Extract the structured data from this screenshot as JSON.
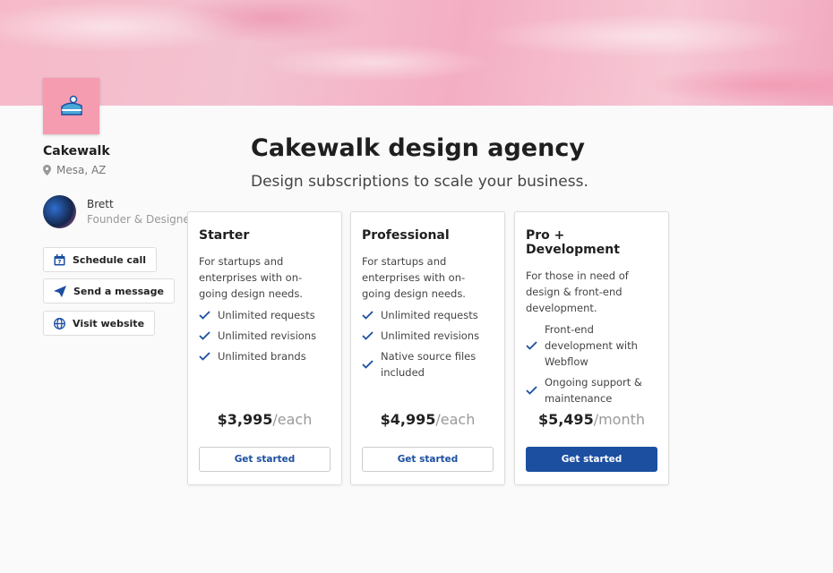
{
  "profile": {
    "name": "Cakewalk",
    "location": "Mesa, AZ",
    "person_name": "Brett",
    "person_role": "Founder & Designer"
  },
  "actions": [
    {
      "label": "Schedule call",
      "icon": "calendar-icon"
    },
    {
      "label": "Send a message",
      "icon": "paper-plane-icon"
    },
    {
      "label": "Visit website",
      "icon": "globe-icon"
    }
  ],
  "header": {
    "title": "Cakewalk design agency",
    "subtitle": "Design subscriptions to scale your business."
  },
  "plans": [
    {
      "title": "Starter",
      "desc": "For startups and enterprises with on-going design needs.",
      "features": [
        "Unlimited requests",
        "Unlimited revisions",
        "Unlimited brands"
      ],
      "price": "$3,995",
      "unit": "/each",
      "cta": "Get started"
    },
    {
      "title": "Professional",
      "desc": "For startups and enterprises with on-going design needs.",
      "features": [
        "Unlimited requests",
        "Unlimited revisions",
        "Native source files included"
      ],
      "price": "$4,995",
      "unit": "/each",
      "cta": "Get started"
    },
    {
      "title": "Pro + Development",
      "desc": "For those in need of design & front-end development.",
      "features": [
        "Front-end development with Webflow",
        "Ongoing support & maintenance"
      ],
      "price": "$5,495",
      "unit": "/month",
      "cta": "Get started"
    }
  ],
  "colors": {
    "accent": "#1c4fa0",
    "logo_bg": "#f59cb1"
  }
}
